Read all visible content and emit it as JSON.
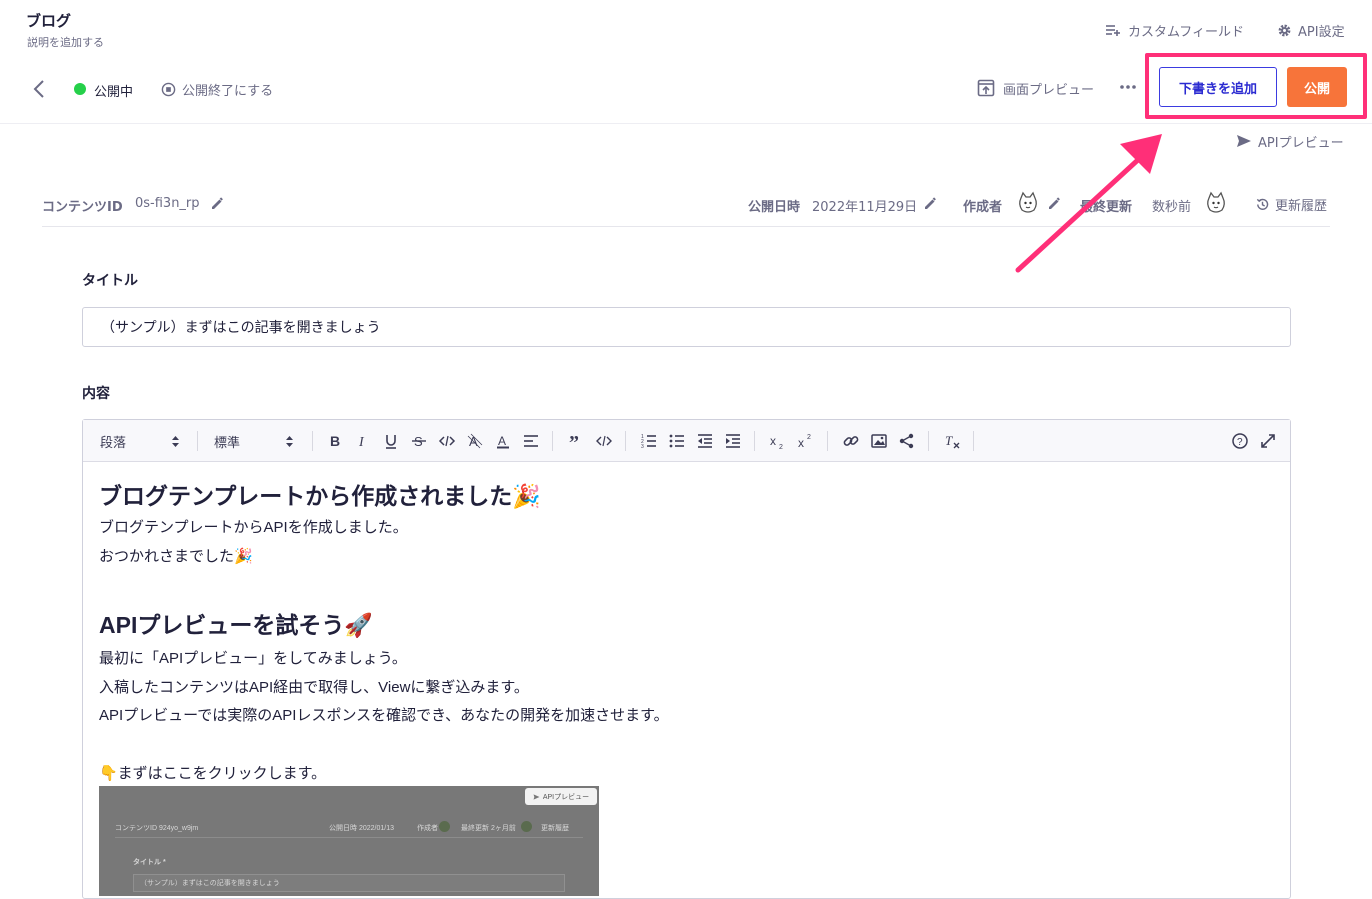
{
  "header": {
    "api_name": "ブログ",
    "api_description": "説明を追加する",
    "custom_field_label": "カスタムフィールド",
    "api_settings_label": "API設定"
  },
  "toolbar": {
    "status_label": "公開中",
    "status_color": "#25d04a",
    "unpublish_label": "公開終了にする",
    "screen_preview_label": "画面プレビュー",
    "draft_button_label": "下書きを追加",
    "publish_button_label": "公開",
    "publish_button_color": "#f7743a",
    "highlight_color": "#ff2f78"
  },
  "api_preview_label": "APIプレビュー",
  "meta": {
    "content_id_label": "コンテンツID",
    "content_id_value": "0s-fi3n_rp",
    "published_at_label": "公開日時",
    "published_at_value": "2022年11月29日",
    "author_label": "作成者",
    "updated_label": "最終更新",
    "updated_value": "数秒前",
    "history_label": "更新履歴"
  },
  "fields": {
    "title_label": "タイトル",
    "title_value": "（サンプル）まずはこの記事を開きましょう",
    "content_label": "内容"
  },
  "editor": {
    "block_format": "段落",
    "font_size": "標準",
    "toolbar_icons": [
      "bold-icon",
      "italic-icon",
      "underline-icon",
      "strikethrough-icon",
      "inline-code-icon",
      "highlight-icon",
      "text-color-icon",
      "align-icon",
      "blockquote-icon",
      "code-block-icon",
      "ordered-list-icon",
      "bullet-list-icon",
      "outdent-icon",
      "indent-icon",
      "subscript-icon",
      "superscript-icon",
      "link-icon",
      "image-icon",
      "embed-icon",
      "clear-format-icon",
      "help-icon",
      "fullscreen-icon"
    ],
    "body": {
      "heading1": "ブログテンプレートから作成されました🎉",
      "p1": "ブログテンプレートからAPIを作成しました。",
      "p2": "おつかれさまでした🎉",
      "heading2": "APIプレビューを試そう🚀",
      "p3": "最初に「APIプレビュー」をしてみましょう。",
      "p4": "入稿したコンテンツはAPI経由で取得し、Viewに繋ぎ込みます。",
      "p5": "APIプレビューでは実際のAPIレスポンスを確認でき、あなたの開発を加速させます。",
      "p6": "👇まずはここをクリックします。"
    },
    "embedded_image": {
      "preview_button": "APIプレビュー",
      "content_id": "コンテンツID 924yo_w9jm",
      "published": "公開日時  2022/01/13",
      "author": "作成者",
      "updated": "最終更新  2ヶ月前",
      "history": "更新履歴",
      "title_label": "タイトル *",
      "title_value": "（サンプル）まずはこの記事を開きましょう"
    }
  }
}
